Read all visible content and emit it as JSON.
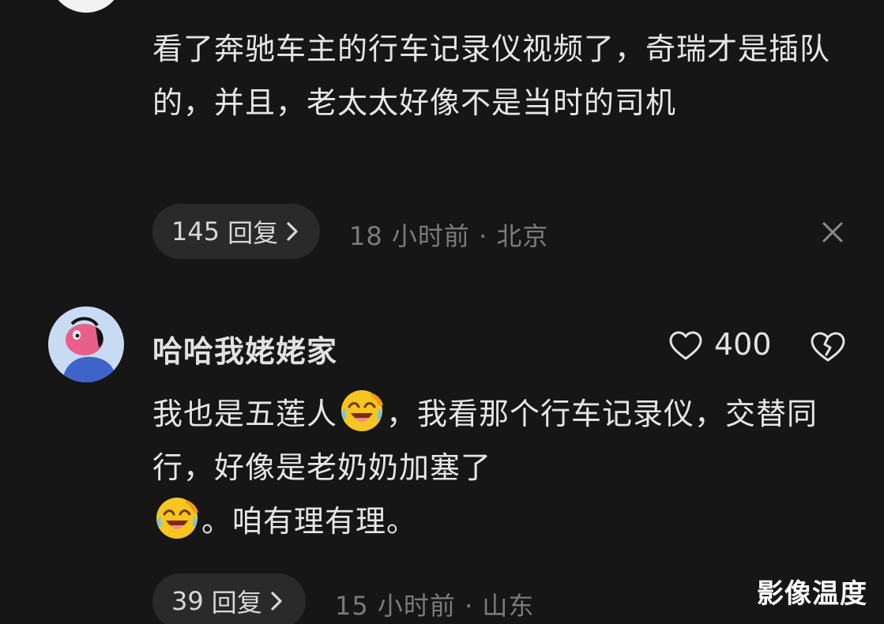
{
  "comments": [
    {
      "text": "看了奔驰车主的行车记录仪视频了，奇瑞才是插队的，并且，老太太好像不是当时的司机",
      "reply_count": "145",
      "reply_label": "回复",
      "time": "18 小时前",
      "separator": "·",
      "location": "北京"
    },
    {
      "username": "哈哈我姥姥家",
      "likes": "400",
      "text_part1": "我也是五莲人",
      "text_part2": "，我看那个行车记录仪，交替同行，好像是老奶奶加塞了",
      "text_part3": "。咱有理有理。",
      "reply_count": "39",
      "reply_label": "回复",
      "time": "15 小时前",
      "separator": "·",
      "location": "山东"
    }
  ],
  "emoji_name": "laughing-crying-emoji",
  "watermark": "影像温度",
  "colors": {
    "background": "#161616",
    "text": "#e6e6e6",
    "meta": "#7b7b7b",
    "pill": "#2a2a2a",
    "emoji_yellow": "#f7c520"
  }
}
